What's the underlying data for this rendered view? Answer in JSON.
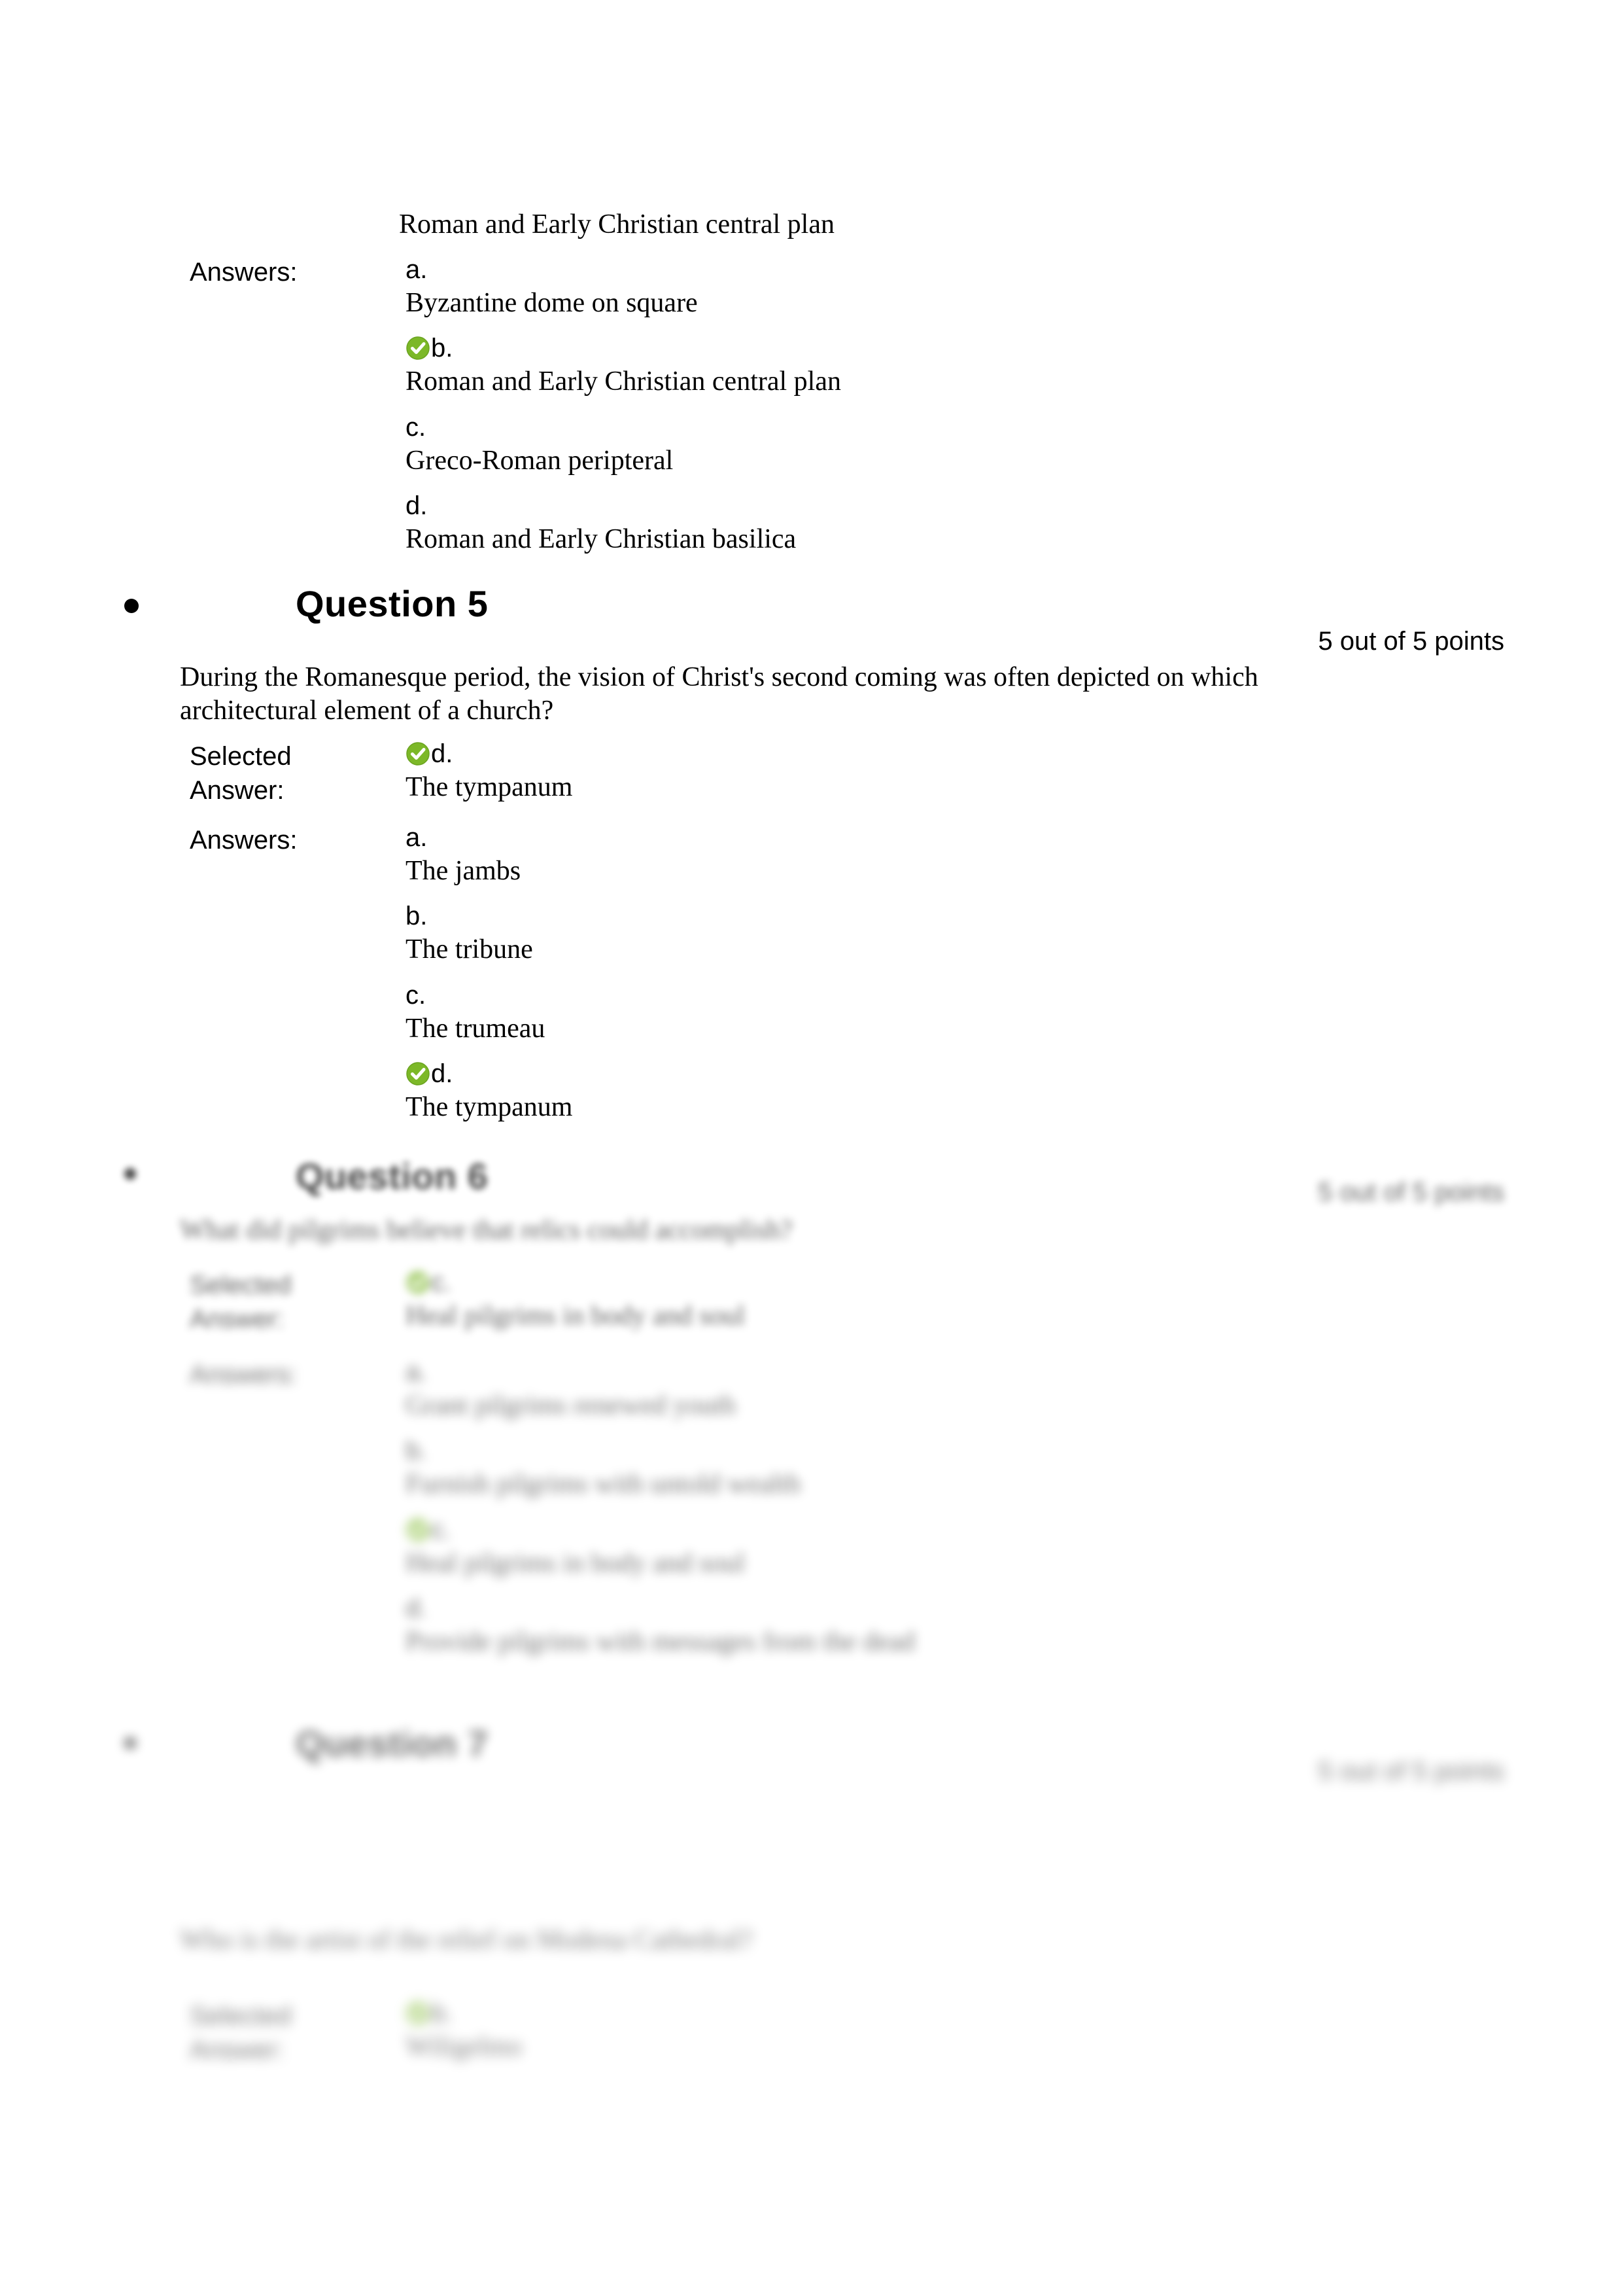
{
  "document": {
    "type": "quiz-results",
    "accent_correct_color": "#7CB828",
    "text_color": "#000000",
    "background_color": "#ffffff"
  },
  "labels": {
    "answers": "Answers:",
    "selected_answer_line1": "Selected",
    "selected_answer_line2": "Answer:"
  },
  "question4_tail": {
    "stem_continuation": "Roman and Early Christian central plan",
    "answers": [
      {
        "letter": "a.",
        "text": "Byzantine dome on square",
        "correct": false
      },
      {
        "letter": "b.",
        "text": "Roman and Early Christian central plan",
        "correct": true
      },
      {
        "letter": "c.",
        "text": "Greco-Roman peripteral",
        "correct": false
      },
      {
        "letter": "d.",
        "text": "Roman and Early Christian basilica",
        "correct": false
      }
    ]
  },
  "question5": {
    "heading": "Question 5",
    "points": "5 out of 5 points",
    "text": "During the Romanesque period, the vision of Christ's second coming was often depicted on which architectural element of a church?",
    "selected": {
      "letter": "d.",
      "text": "The tympanum",
      "correct": true
    },
    "answers": [
      {
        "letter": "a.",
        "text": "The jambs",
        "correct": false
      },
      {
        "letter": "b.",
        "text": "The tribune",
        "correct": false
      },
      {
        "letter": "c.",
        "text": "The trumeau",
        "correct": false
      },
      {
        "letter": "d.",
        "text": "The tympanum",
        "correct": true
      }
    ]
  },
  "question6": {
    "heading": "Question 6",
    "points": "5 out of 5 points",
    "text": "What did pilgrims believe that relics could accomplish?",
    "selected": {
      "letter": "c.",
      "text": "Heal pilgrims in body and soul",
      "correct": true
    },
    "answers": [
      {
        "letter": "a.",
        "text": "Grant pilgrims renewed youth",
        "correct": false
      },
      {
        "letter": "b.",
        "text": "Furnish pilgrims with untold wealth",
        "correct": false
      },
      {
        "letter": "c.",
        "text": "Heal pilgrims in body and soul",
        "correct": true
      },
      {
        "letter": "d.",
        "text": "Provide pilgrims with messages from the dead",
        "correct": false
      }
    ]
  },
  "question7": {
    "heading": "Question 7",
    "points": "5 out of 5 points",
    "text": "Who is the artist of the relief on Modena Cathedral?",
    "selected": {
      "letter": "b.",
      "text": "Wiligelmo",
      "correct": true
    }
  }
}
